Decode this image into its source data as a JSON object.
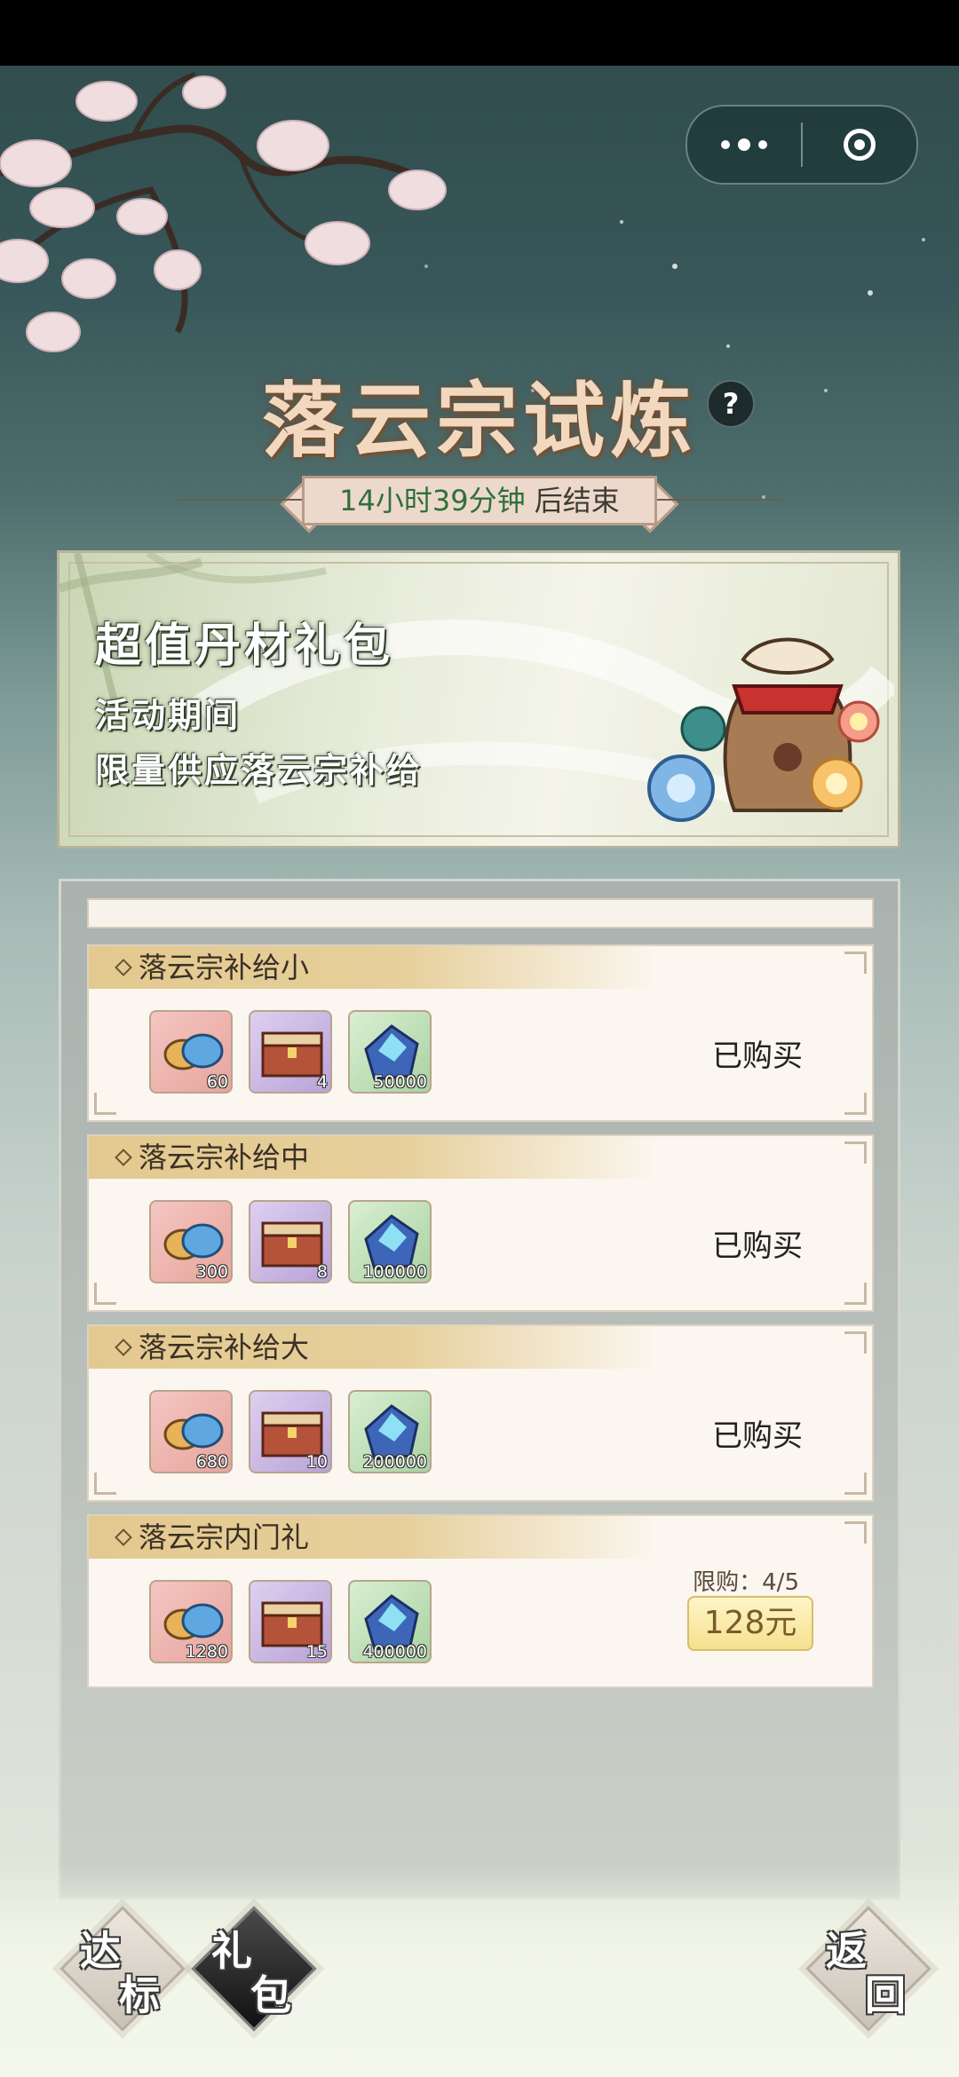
{
  "topbar": {
    "more_icon": "more-dots-icon",
    "close_icon": "target-circle-icon"
  },
  "header": {
    "title": "落云宗试炼",
    "help_glyph": "?",
    "timer": {
      "time": "14小时39分钟",
      "suffix": "后结束"
    }
  },
  "banner": {
    "title": "超值丹材礼包",
    "line1": "活动期间",
    "line2": "限量供应落云宗补给"
  },
  "packs": [
    {
      "name": "落云宗补给小",
      "items": [
        {
          "qty": "60"
        },
        {
          "qty": "4"
        },
        {
          "qty": "50000"
        }
      ],
      "status": "已购买"
    },
    {
      "name": "落云宗补给中",
      "items": [
        {
          "qty": "300"
        },
        {
          "qty": "8"
        },
        {
          "qty": "100000"
        }
      ],
      "status": "已购买"
    },
    {
      "name": "落云宗补给大",
      "items": [
        {
          "qty": "680"
        },
        {
          "qty": "10"
        },
        {
          "qty": "200000"
        }
      ],
      "status": "已购买"
    },
    {
      "name": "落云宗内门礼",
      "items": [
        {
          "qty": "1280"
        },
        {
          "qty": "15"
        },
        {
          "qty": "400000"
        }
      ],
      "limit": "限购：4/5",
      "price": "128元"
    }
  ],
  "nav": {
    "achieve": {
      "c1": "达",
      "c2": "标"
    },
    "gift": {
      "c1": "礼",
      "c2": "包"
    },
    "back": {
      "c1": "返",
      "c2": "回"
    }
  },
  "colors": {
    "accent_gold": "#e3c98f",
    "title": "#f1d8bf",
    "timer_green": "#2f6f3a"
  }
}
